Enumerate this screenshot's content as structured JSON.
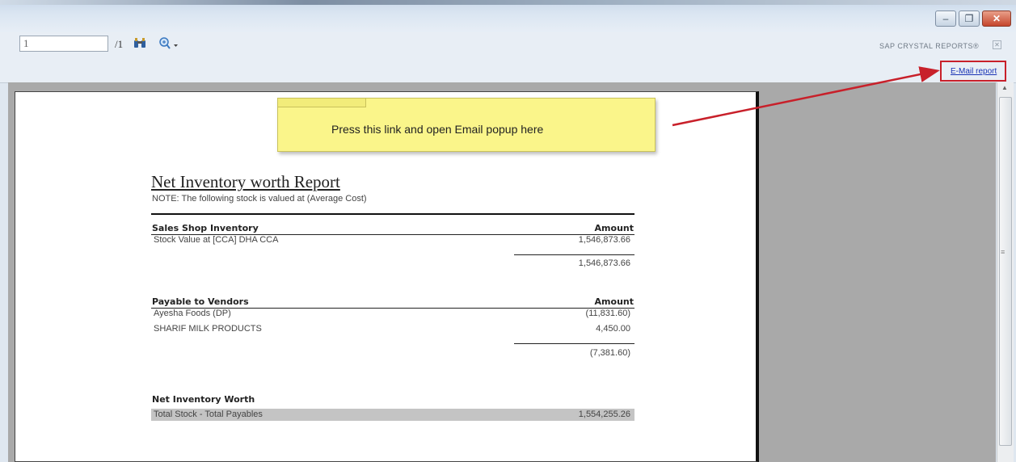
{
  "toolbar": {
    "page_current": "1",
    "page_total": "/1",
    "brand": "SAP CRYSTAL REPORTS®",
    "email_link": "E-Mail report"
  },
  "window_controls": {
    "minimize": "–",
    "restore": "❐",
    "close": "✕"
  },
  "annotation": {
    "text": "Press this link and open Email popup here",
    "arrow_color": "#c8202a",
    "note_color": "#faf58a"
  },
  "report": {
    "title": "Net Inventory worth Report",
    "note": "NOTE: The following stock is valued at (Average Cost)",
    "sections": [
      {
        "heading": "Sales Shop Inventory",
        "amount_header": "Amount",
        "rows": [
          {
            "label": "Stock Value at [CCA] DHA CCA",
            "amount": "1,546,873.66"
          }
        ],
        "total": "1,546,873.66"
      },
      {
        "heading": "Payable to Vendors",
        "amount_header": "Amount",
        "rows": [
          {
            "label": "Ayesha Foods (DP)",
            "amount": "(11,831.60)"
          },
          {
            "label": "SHARIF MILK PRODUCTS",
            "amount": "4,450.00"
          }
        ],
        "total": "(7,381.60)"
      }
    ],
    "net": {
      "heading": "Net Inventory Worth",
      "label": "Total Stock  - Total Payables",
      "amount": "1,554,255.26"
    }
  }
}
